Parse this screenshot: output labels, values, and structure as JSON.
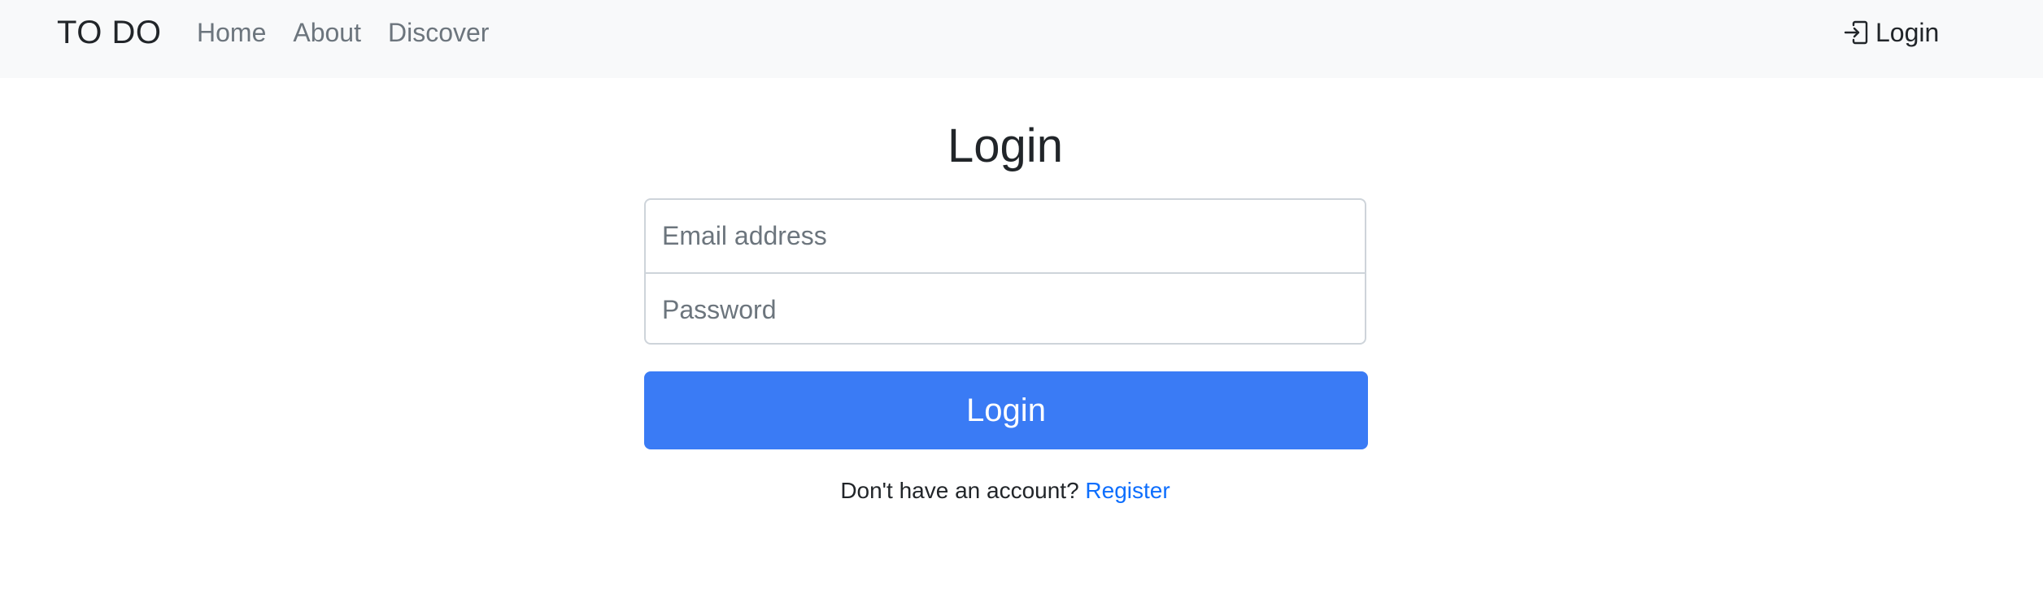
{
  "navbar": {
    "brand": "TO DO",
    "links": [
      {
        "label": "Home"
      },
      {
        "label": "About"
      },
      {
        "label": "Discover"
      }
    ],
    "login_label": "Login",
    "login_icon": "login-arrow-icon"
  },
  "main": {
    "title": "Login",
    "email": {
      "placeholder": "Email address",
      "value": ""
    },
    "password": {
      "placeholder": "Password",
      "value": ""
    },
    "submit_label": "Login",
    "register_prompt": "Don't have an account?",
    "register_link": "Register"
  },
  "colors": {
    "navbar_bg": "#f8f9fa",
    "primary_button": "#3a7bf5",
    "link": "#0d6efd",
    "muted_text": "#6c757d"
  }
}
